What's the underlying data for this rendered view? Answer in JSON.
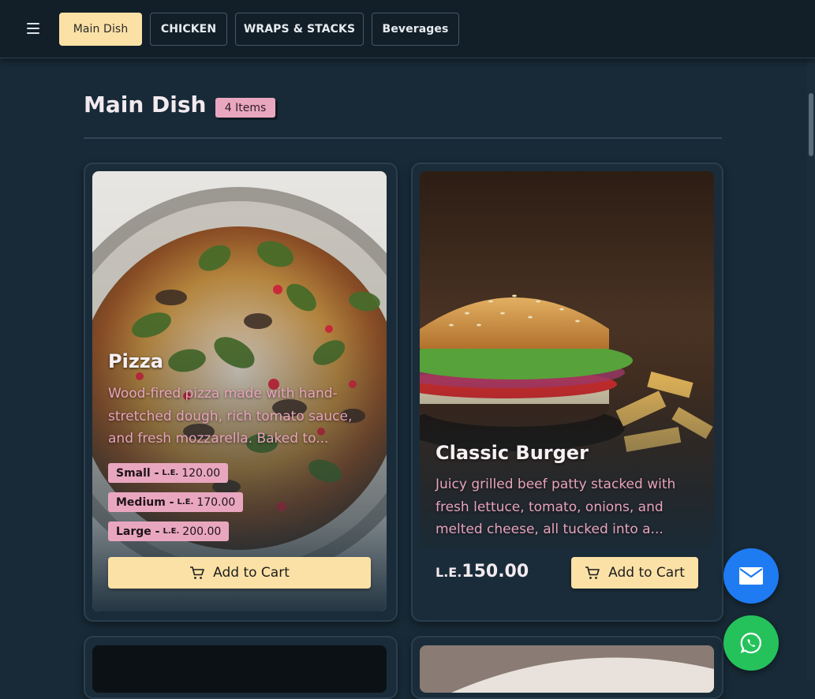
{
  "nav": {
    "menu_icon": "hamburger-menu-icon",
    "tabs": [
      {
        "label": "Main Dish",
        "active": true
      },
      {
        "label": "CHICKEN",
        "active": false
      },
      {
        "label": "WRAPS & STACKS",
        "active": false
      },
      {
        "label": "Beverages",
        "active": false
      }
    ]
  },
  "section": {
    "title": "Main Dish",
    "count": "4 Items"
  },
  "items": [
    {
      "name": "Pizza",
      "description_lines": [
        "Wood-fired pizza made with hand-",
        "stretched dough, rich tomato sauce,",
        "and fresh mozzarella. Baked to..."
      ],
      "sizes": [
        {
          "size": "Small -",
          "currency": "L.E.",
          "amount": "120.00"
        },
        {
          "size": "Medium -",
          "currency": "L.E.",
          "amount": "170.00"
        },
        {
          "size": "Large -",
          "currency": "L.E.",
          "amount": "200.00"
        }
      ],
      "button": "Add to Cart"
    },
    {
      "name": "Classic Burger",
      "description_lines": [
        "Juicy grilled beef patty stacked with",
        "fresh lettuce, tomato, onions, and",
        "melted cheese, all tucked into a..."
      ],
      "price_currency": "L.E.",
      "price_amount": "150.00",
      "button": "Add to Cart"
    }
  ],
  "fabs": {
    "email_icon": "envelope-icon",
    "whatsapp_icon": "whatsapp-icon",
    "email_color": "#1e7bf2",
    "whatsapp_color": "#25c25c"
  },
  "colors": {
    "accent_yellow": "#fbe1a6",
    "accent_pink": "#e9a7bf",
    "background": "#182a37"
  }
}
